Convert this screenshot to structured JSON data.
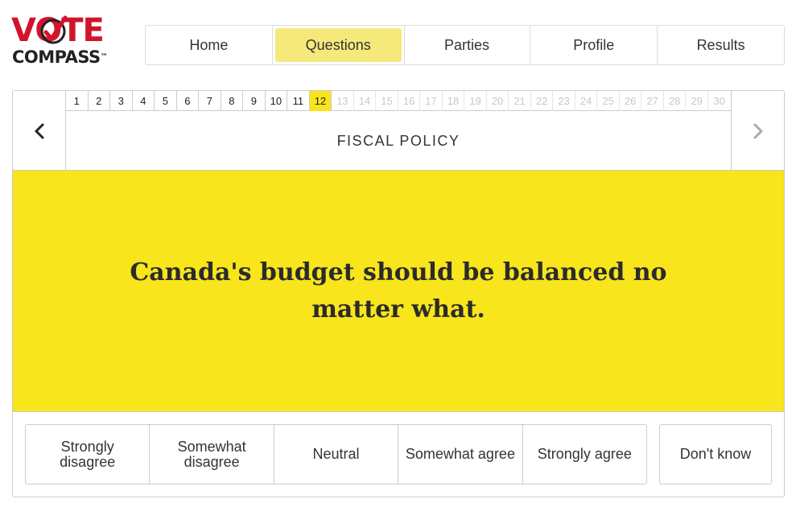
{
  "logo": {
    "line1": "VOTE",
    "line2": "COMPASS",
    "tm": "™",
    "accent": "#d2142b"
  },
  "nav": {
    "items": [
      {
        "label": "Home",
        "active": false
      },
      {
        "label": "Questions",
        "active": true
      },
      {
        "label": "Parties",
        "active": false
      },
      {
        "label": "Profile",
        "active": false
      },
      {
        "label": "Results",
        "active": false
      }
    ]
  },
  "question_nav": {
    "numbers": [
      "1",
      "2",
      "3",
      "4",
      "5",
      "6",
      "7",
      "8",
      "9",
      "10",
      "11",
      "12",
      "13",
      "14",
      "15",
      "16",
      "17",
      "18",
      "19",
      "20",
      "21",
      "22",
      "23",
      "24",
      "25",
      "26",
      "27",
      "28",
      "29",
      "30"
    ],
    "current": 12,
    "prev_icon": "chevron-left-icon",
    "next_icon": "chevron-right-icon"
  },
  "topic": "FISCAL POLICY",
  "question": "Canada's budget should be balanced no matter what.",
  "answers": {
    "options": [
      "Strongly disagree",
      "Somewhat disagree",
      "Neutral",
      "Somewhat agree",
      "Strongly agree"
    ],
    "dont_know": "Don't know"
  },
  "colors": {
    "highlight": "#f8e51b",
    "nav_active": "#f6e97b"
  }
}
